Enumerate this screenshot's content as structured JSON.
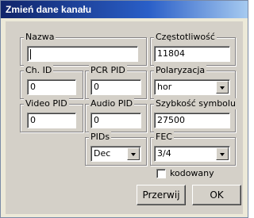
{
  "window": {
    "title": "Zmień dane kanału"
  },
  "fields": {
    "nazwa": {
      "label": "Nazwa",
      "value": ""
    },
    "czestotliwosc": {
      "label": "Częstotliwość",
      "value": "11804"
    },
    "ch_id": {
      "label": "Ch. ID",
      "value": "0"
    },
    "pcr_pid": {
      "label": "PCR PID",
      "value": "0"
    },
    "polaryzacja": {
      "label": "Polaryzacja",
      "value": "hor"
    },
    "video_pid": {
      "label": "Video PID",
      "value": "0"
    },
    "audio_pid": {
      "label": "Audio PID",
      "value": "0"
    },
    "szybkosc_symbolu": {
      "label": "Szybkość symbolu",
      "value": "27500"
    },
    "pids": {
      "label": "PIDs",
      "value": "Dec"
    },
    "fec": {
      "label": "FEC",
      "value": "3/4"
    }
  },
  "checkbox": {
    "label": "kodowany",
    "checked": false
  },
  "buttons": {
    "cancel": "Przerwij",
    "ok": "OK"
  }
}
